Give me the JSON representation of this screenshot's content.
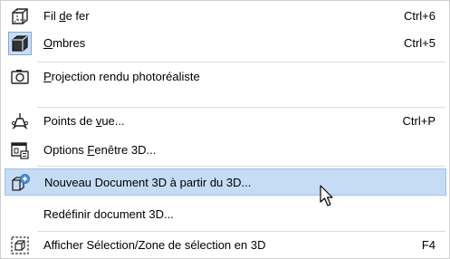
{
  "menu": {
    "items": [
      {
        "icon": "wireframe-icon",
        "pre": "Fil ",
        "acc": "d",
        "post": "e fer",
        "shortcut": "Ctrl+6"
      },
      {
        "icon": "shadows-icon",
        "pre": "",
        "acc": "O",
        "post": "mbres",
        "shortcut": "Ctrl+5"
      },
      {
        "icon": "camera-icon",
        "pre": "",
        "acc": "P",
        "post": "rojection rendu photoréaliste",
        "shortcut": ""
      },
      {
        "icon": "viewpoints-icon",
        "pre": "Points de ",
        "acc": "v",
        "post": "ue...",
        "shortcut": "Ctrl+P"
      },
      {
        "icon": "window-options-icon",
        "pre": "Options ",
        "acc": "F",
        "post": "enêtre 3D...",
        "shortcut": ""
      },
      {
        "icon": "new-3d-document-icon",
        "pre": "Nouveau Document 3D à partir du 3D...",
        "acc": "",
        "post": "",
        "shortcut": ""
      },
      {
        "icon": "",
        "pre": "Redéfinir document 3D...",
        "acc": "",
        "post": "",
        "shortcut": ""
      },
      {
        "icon": "selection-3d-icon",
        "pre": "Afficher Sélection/Zone de sélection en 3D",
        "acc": "",
        "post": "",
        "shortcut": "F4"
      }
    ]
  }
}
